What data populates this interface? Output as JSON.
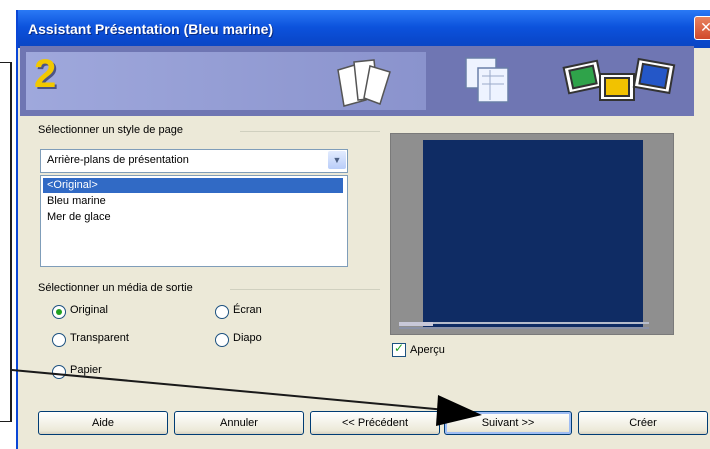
{
  "window": {
    "title": "Assistant Présentation (Bleu marine)",
    "close_glyph": "✕"
  },
  "banner": {
    "step_number": "2",
    "icons": [
      "pages-icon",
      "layout-icon",
      "slides-icon"
    ]
  },
  "page_style": {
    "group_label": "Sélectionner un style de page",
    "dropdown_value": "Arrière-plans de présentation",
    "list_items": [
      "<Original>",
      "Bleu marine",
      "Mer de glace"
    ],
    "selected_index": 0
  },
  "output_media": {
    "group_label": "Sélectionner un média de sortie",
    "options": [
      "Original",
      "Écran",
      "Transparent",
      "Diapo",
      "Papier"
    ],
    "selected": "Original"
  },
  "preview": {
    "checkbox_label": "Aperçu",
    "checked": true
  },
  "buttons": {
    "help": "Aide",
    "cancel": "Annuler",
    "previous": "<< Précédent",
    "next": "Suivant >>",
    "create": "Créer"
  },
  "colors": {
    "titlebar": "#0a48cc",
    "banner": "#6f76b3",
    "step_number": "#f2c800",
    "slide_background": "#0f2c64",
    "selection": "#316ac5"
  }
}
